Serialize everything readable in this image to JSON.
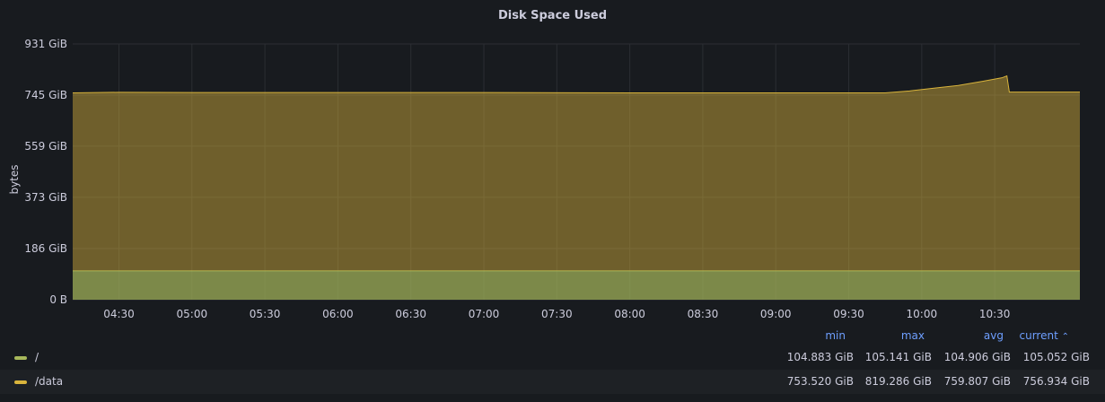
{
  "panel": {
    "title": "Disk Space Used"
  },
  "legend": {
    "headers": {
      "min": "min",
      "max": "max",
      "avg": "avg",
      "current": "current",
      "sort_indicator": "^"
    },
    "rows": [
      {
        "name": "/",
        "color": "#a7b85b",
        "min": "104.883 GiB",
        "max": "105.141 GiB",
        "avg": "104.906 GiB",
        "current": "105.052 GiB"
      },
      {
        "name": "/data",
        "color": "#d9b43c",
        "min": "753.520 GiB",
        "max": "819.286 GiB",
        "avg": "759.807 GiB",
        "current": "756.934 GiB"
      }
    ]
  },
  "chart_data": {
    "type": "area",
    "stacked": true,
    "title": "Disk Space Used",
    "ylabel": "bytes",
    "xlabel": "",
    "y_unit": "GiB",
    "ylim": [
      0,
      931
    ],
    "y_ticks": [
      {
        "value": 0,
        "label": "0 B"
      },
      {
        "value": 186,
        "label": "186 GiB"
      },
      {
        "value": 373,
        "label": "373 GiB"
      },
      {
        "value": 559,
        "label": "559 GiB"
      },
      {
        "value": 745,
        "label": "745 GiB"
      },
      {
        "value": 931,
        "label": "931 GiB"
      }
    ],
    "xlim": [
      "04:11",
      "11:05"
    ],
    "x_ticks": [
      "04:30",
      "05:00",
      "05:30",
      "06:00",
      "06:30",
      "07:00",
      "07:30",
      "08:00",
      "08:30",
      "09:00",
      "09:30",
      "10:00",
      "10:30"
    ],
    "grid": true,
    "legend_position": "bottom",
    "series": [
      {
        "name": "/",
        "color": "#a7b85b",
        "points": [
          [
            "04:11",
            105
          ],
          [
            "05:00",
            105
          ],
          [
            "06:00",
            105
          ],
          [
            "07:00",
            105
          ],
          [
            "08:00",
            105
          ],
          [
            "09:00",
            105
          ],
          [
            "10:00",
            105
          ],
          [
            "10:35",
            105
          ],
          [
            "11:05",
            105
          ]
        ]
      },
      {
        "name": "/data",
        "color": "#d9b43c",
        "points": [
          [
            "04:11",
            753
          ],
          [
            "04:30",
            755
          ],
          [
            "05:00",
            754
          ],
          [
            "06:00",
            754
          ],
          [
            "07:00",
            754
          ],
          [
            "08:00",
            753
          ],
          [
            "09:00",
            753
          ],
          [
            "09:45",
            753
          ],
          [
            "09:55",
            760
          ],
          [
            "10:05",
            770
          ],
          [
            "10:15",
            780
          ],
          [
            "10:25",
            795
          ],
          [
            "10:33",
            808
          ],
          [
            "10:35",
            815
          ],
          [
            "10:36",
            756
          ],
          [
            "11:05",
            756
          ]
        ]
      }
    ]
  }
}
